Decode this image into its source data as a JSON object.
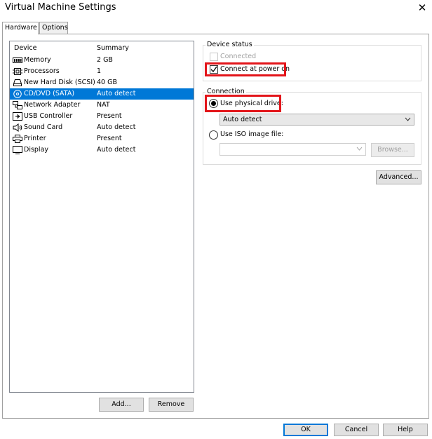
{
  "window": {
    "title": "Virtual Machine Settings",
    "close_glyph": "✕"
  },
  "tabs": [
    {
      "label": "Hardware"
    },
    {
      "label": "Options"
    }
  ],
  "device_list": {
    "columns": {
      "device": "Device",
      "summary": "Summary"
    },
    "rows": [
      {
        "device": "Memory",
        "summary": "2 GB",
        "icon": "memory-icon"
      },
      {
        "device": "Processors",
        "summary": "1",
        "icon": "processor-icon"
      },
      {
        "device": "New Hard Disk (SCSI)",
        "summary": "40 GB",
        "icon": "hard-disk-icon"
      },
      {
        "device": "CD/DVD (SATA)",
        "summary": "Auto detect",
        "icon": "cd-dvd-icon",
        "selected": true
      },
      {
        "device": "Network Adapter",
        "summary": "NAT",
        "icon": "network-adapter-icon"
      },
      {
        "device": "USB Controller",
        "summary": "Present",
        "icon": "usb-icon"
      },
      {
        "device": "Sound Card",
        "summary": "Auto detect",
        "icon": "speaker-icon"
      },
      {
        "device": "Printer",
        "summary": "Present",
        "icon": "printer-icon"
      },
      {
        "device": "Display",
        "summary": "Auto detect",
        "icon": "display-icon"
      }
    ]
  },
  "list_buttons": {
    "add": "Add...",
    "remove": "Remove"
  },
  "device_status": {
    "title": "Device status",
    "connected_label": "Connected",
    "connected_checked": false,
    "connect_power_label": "Connect at power on",
    "connect_power_checked": true
  },
  "connection": {
    "title": "Connection",
    "physical_label": "Use physical drive:",
    "physical_selected": true,
    "drive_value": "Auto detect",
    "iso_label": "Use ISO image file:",
    "iso_selected": false,
    "iso_value": "",
    "browse_label": "Browse..."
  },
  "advanced_label": "Advanced...",
  "footer": {
    "ok": "OK",
    "cancel": "Cancel",
    "help": "Help"
  },
  "colors": {
    "selection": "#0078d7",
    "highlight": "#e3151a"
  }
}
